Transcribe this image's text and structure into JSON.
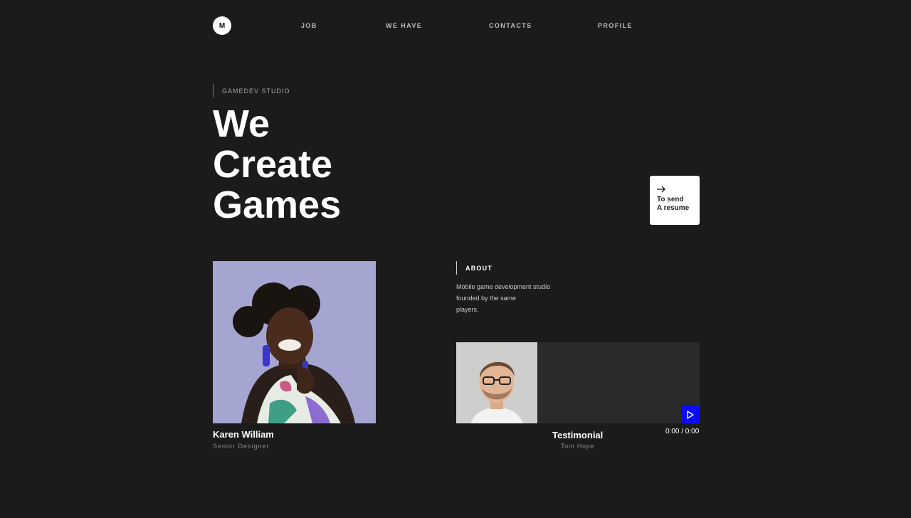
{
  "header": {
    "logo_text": "M",
    "nav": [
      "JOB",
      "WE HAVE",
      "CONTACTS",
      "PROFILE"
    ]
  },
  "hero": {
    "eyebrow": "GAMEDEV STUDIO",
    "title_lines": [
      "We",
      "Create",
      "Games"
    ]
  },
  "resume_card": {
    "icon": "arrow-right-icon",
    "lines": [
      "To send",
      "A resume"
    ]
  },
  "team_member": {
    "name": "Karen William",
    "role": "Senior Designer"
  },
  "about": {
    "label": "ABOUT",
    "text_lines": [
      "Mobile game development studio",
      "founded by the same",
      "players."
    ]
  },
  "testimonial": {
    "title": "Testimonial",
    "author": "Tom Hope",
    "time": "0:00 / 0:00",
    "play_icon": "play-icon",
    "play_button_color": "#0a0aff"
  }
}
